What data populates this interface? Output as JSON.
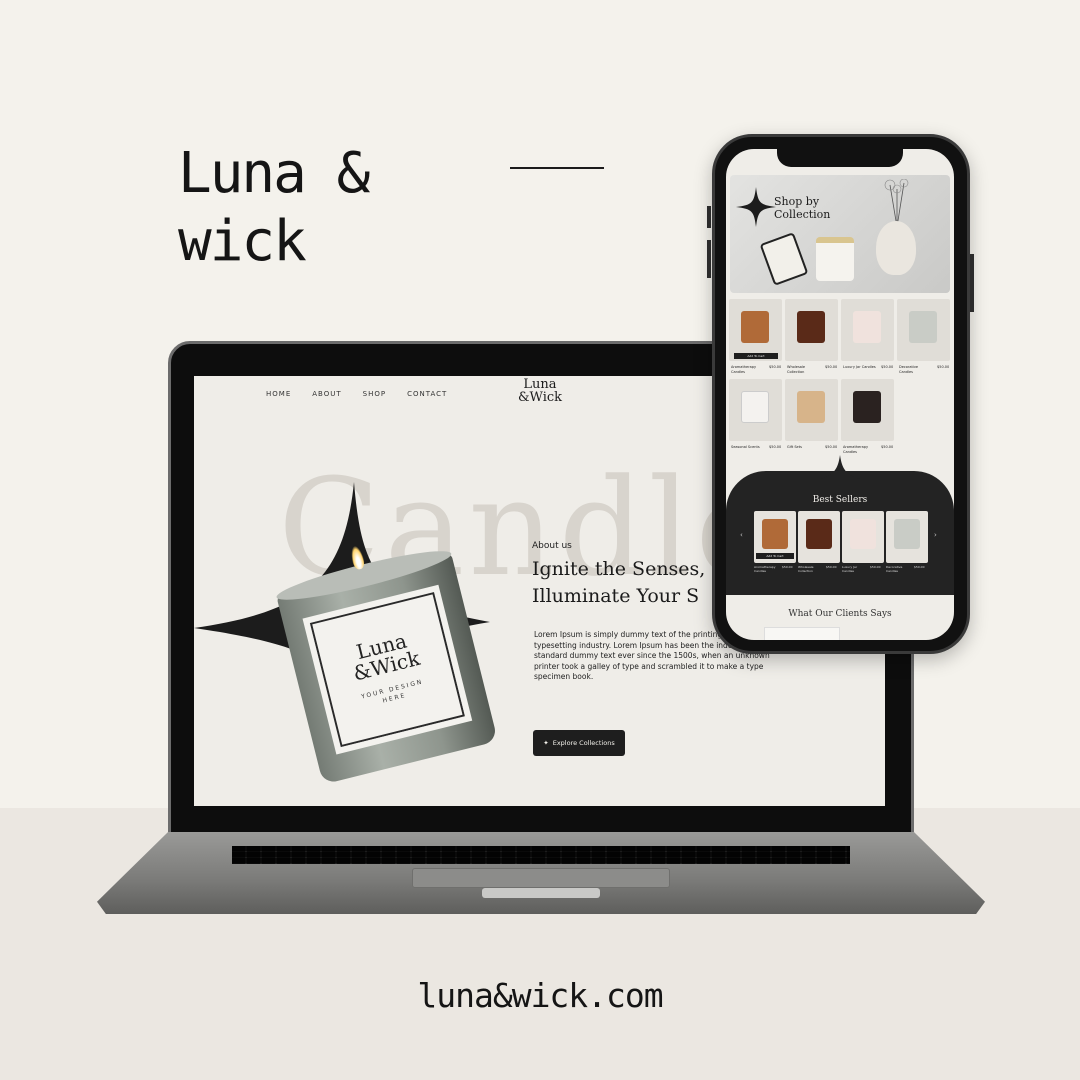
{
  "brand": {
    "line1": "Luna &",
    "line2": "wick"
  },
  "domain": "luna&wick.com",
  "laptop_site": {
    "nav": [
      "HOME",
      "ABOUT",
      "SHOP",
      "CONTACT"
    ],
    "logo_line1": "Luna",
    "logo_line2": "&Wick",
    "background_word": "Candles",
    "about_label": "About us",
    "headline_line1": "Ignite the Senses,",
    "headline_line2": "Illuminate Your S",
    "body": "Lorem Ipsum is simply dummy text of the printing and typesetting industry. Lorem Ipsum has been the industry's standard dummy text ever since the 1500s, when an unknown printer took a galley of type and scrambled it to make a type specimen book.",
    "cta": "Explore Collections",
    "cta_icon": "sparkle-icon",
    "candle_label_logo1": "Luna",
    "candle_label_logo2": "&Wick",
    "candle_label_sub": "YOUR DESIGN HERE"
  },
  "phone_site": {
    "hero_title_line1": "Shop by",
    "hero_title_line2": "Collection",
    "products": [
      {
        "name": "Aromatherapy Candles",
        "price": "$50.00",
        "color": "#b06a38",
        "button": "Add To Cart"
      },
      {
        "name": "Wholesale Collection",
        "price": "$50.00",
        "color": "#5a2a18"
      },
      {
        "name": "Luxury Jar Candles",
        "price": "$50.00",
        "color": "#f0e2dd"
      },
      {
        "name": "Decorative Candles",
        "price": "$50.00",
        "color": "#c9ccc6"
      },
      {
        "name": "Seasonal Scents",
        "price": "$50.00",
        "color": "#f4f2ef"
      },
      {
        "name": "Gift Sets",
        "price": "$50.00",
        "color": "#d7b48a"
      },
      {
        "name": "Aromatherapy Candles",
        "price": "$50.00",
        "color": "#2a2220"
      }
    ],
    "best_sellers_title": "Best Sellers",
    "best_sellers": [
      {
        "name": "Aromatherapy Candles",
        "price": "$50.00",
        "color": "#b06a38",
        "button": "Add To Cart"
      },
      {
        "name": "Wholesale Collection",
        "price": "$50.00",
        "color": "#5a2a18"
      },
      {
        "name": "Luxury Jar Candles",
        "price": "$50.00",
        "color": "#f0e2dd"
      },
      {
        "name": "Decorative Candles",
        "price": "$50.00",
        "color": "#c9ccc6"
      }
    ],
    "clients_title": "What Our Clients Says",
    "prev_arrow": "‹",
    "next_arrow": "›"
  },
  "colors": {
    "background": "#f4f2ec",
    "floor": "#ebe7e1",
    "dark": "#1e1e1e",
    "accent_text": "#151515"
  }
}
